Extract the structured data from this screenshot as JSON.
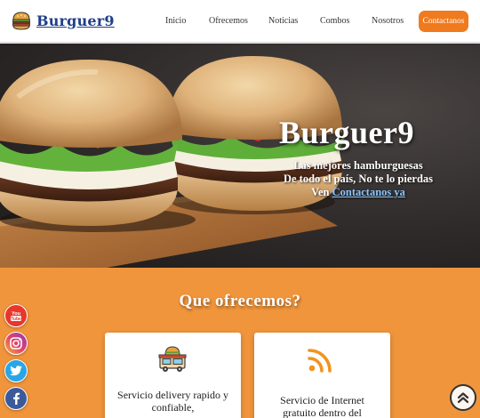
{
  "header": {
    "brand": "Burguer9",
    "nav": [
      "Inicio",
      "Ofrecemos",
      "Noticias",
      "Combos",
      "Nosotros"
    ],
    "cta": "Contactanos"
  },
  "hero": {
    "title": "Burguer9",
    "line1": "Las mejores hamburguesas",
    "line2": "De todo el país, No te lo pierdas",
    "line3_prefix": "Ven ",
    "line3_link": "Contactanos ya"
  },
  "offer": {
    "title": "Que ofrecemos?",
    "cards": [
      {
        "icon": "food-truck-icon",
        "text": "Servicio delivery rapido y confiable,"
      },
      {
        "icon": "wifi-icon",
        "text": "Servicio de Internet gratuito dentro del"
      }
    ]
  },
  "social": [
    "youtube-icon",
    "instagram-icon",
    "twitter-icon",
    "facebook-icon"
  ],
  "colors": {
    "accent": "#f07a1e",
    "section_bg": "#f0953c",
    "brand_text": "#1f3e8a",
    "link": "#8bc6ff"
  }
}
